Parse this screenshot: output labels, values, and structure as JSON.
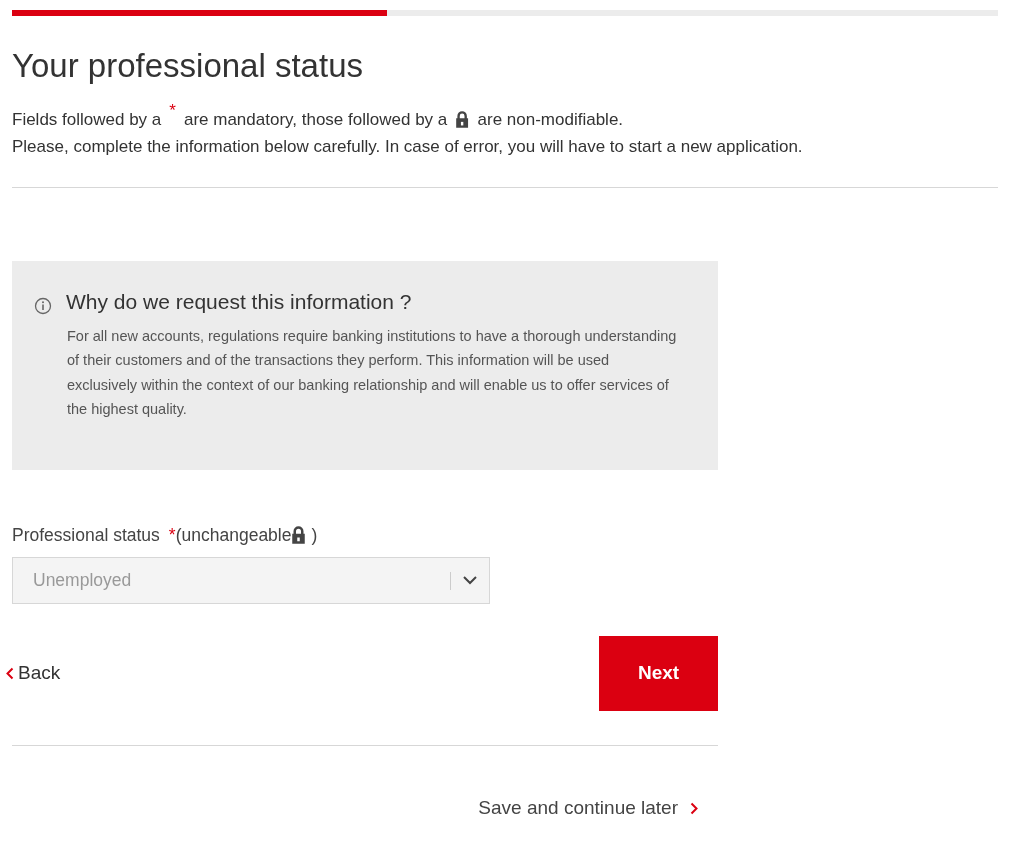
{
  "progress": {
    "level": 0.38
  },
  "title": "Your professional status",
  "legend": {
    "before_required": "Fields followed by a",
    "required_mark": "*",
    "after_required": "are mandatory, those followed by a",
    "after_lock": "are non-modifiable."
  },
  "instruction": "Please, complete the information below carefully. In case of error, you will have to start a new application.",
  "info": {
    "title": "Why do we request this information ?",
    "text": "For all new accounts, regulations require banking institutions to have a thorough understanding of their customers and of the transactions they perform. This information will be used exclusively within the context of our banking relationship and will enable us to offer services of the highest quality."
  },
  "field": {
    "label": "Professional status",
    "required_mark": "*",
    "note_open": "(unchangeable",
    "note_close": ")",
    "value": "Unemployed",
    "disabled": true
  },
  "back": "Back",
  "next": "Next",
  "save_later": "Save and continue later"
}
